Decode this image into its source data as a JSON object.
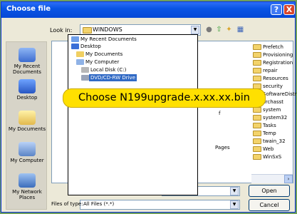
{
  "window": {
    "title": "Choose file",
    "help_label": "?",
    "close_label": "X"
  },
  "look_in": {
    "label": "Look in:",
    "value": "WINDOWS"
  },
  "places": [
    {
      "label": "My Recent\nDocuments",
      "icon": "recent-documents-icon"
    },
    {
      "label": "Desktop",
      "icon": "desktop-icon"
    },
    {
      "label": "My Documents",
      "icon": "my-documents-icon"
    },
    {
      "label": "My Computer",
      "icon": "my-computer-icon"
    },
    {
      "label": "My Network\nPlaces",
      "icon": "network-places-icon"
    }
  ],
  "dropdown_items": [
    {
      "label": "My Recent Documents",
      "icon": "recent-documents-icon"
    },
    {
      "label": "Desktop",
      "icon": "desktop-icon"
    },
    {
      "label": "My Documents",
      "icon": "my-documents-icon"
    },
    {
      "label": "My Computer",
      "icon": "my-computer-icon"
    },
    {
      "label": "Local Disk (C:)",
      "icon": "local-disk-icon"
    },
    {
      "label": "DVD/CD-RW Drive",
      "icon": "dvd-drive-icon",
      "selected": true
    }
  ],
  "files": [
    "Prefetch",
    "Provisioning",
    "Registration",
    "repair",
    "Resources",
    "security",
    "SoftwareDistrit",
    "srchasst",
    "system",
    "system32",
    "Tasks",
    "Temp",
    "twain_32",
    "Web",
    "WinSxS"
  ],
  "partial_text": {
    "pages": "Pages",
    "f": "f"
  },
  "callout": "Choose N199upgrade.x.xx.xx.bin",
  "files_of_type": {
    "label": "Files of type:",
    "value": "All Files (*.*)"
  },
  "buttons": {
    "open": "Open",
    "cancel": "Cancel"
  },
  "colors": {
    "titlebar": "#0a55e5",
    "callout": "#ffe000",
    "selection": "#316ac5"
  }
}
